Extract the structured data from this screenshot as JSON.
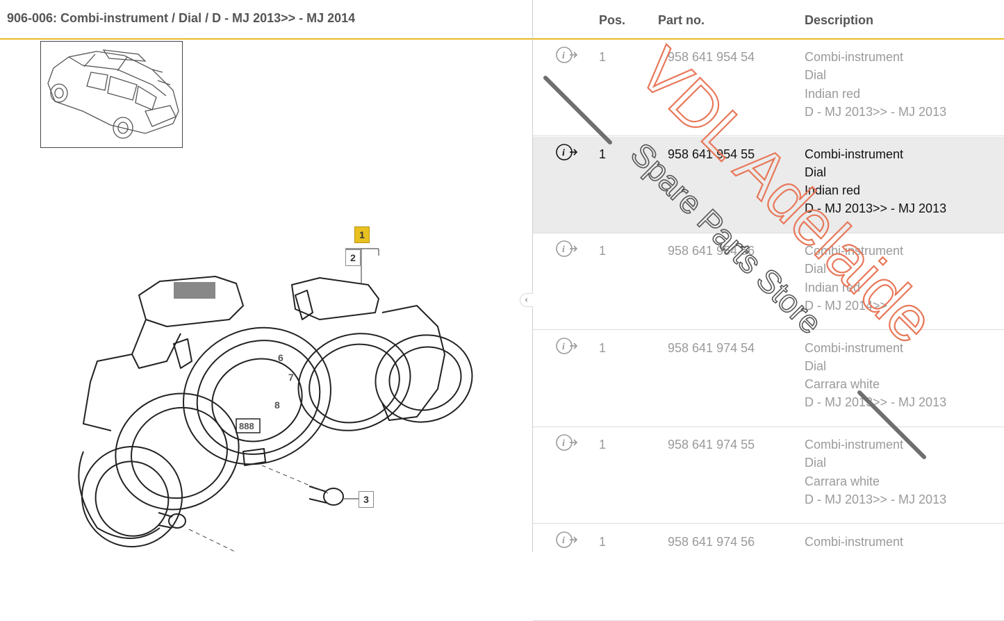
{
  "header": {
    "title": "906-006: Combi-instrument / Dial / D - MJ 2013>> - MJ 2014"
  },
  "columns": {
    "pos": "Pos.",
    "part_no": "Part no.",
    "description": "Description"
  },
  "rows": [
    {
      "pos": "1",
      "part_no": "958 641 954 54",
      "desc": [
        "Combi-instrument",
        "Dial",
        "Indian red",
        "D -    MJ 2013>> -    MJ 2013"
      ],
      "selected": false
    },
    {
      "pos": "1",
      "part_no": "958 641 954 55",
      "desc": [
        "Combi-instrument",
        "Dial",
        "Indian red",
        "D -    MJ 2013>> -    MJ 2013"
      ],
      "selected": true
    },
    {
      "pos": "1",
      "part_no": "958 641 954 56",
      "desc": [
        "Combi-instrument",
        "Dial",
        "Indian red",
        "D -    MJ 2014>>"
      ],
      "selected": false
    },
    {
      "pos": "1",
      "part_no": "958 641 974 54",
      "desc": [
        "Combi-instrument",
        "Dial",
        "Carrara white",
        "D -    MJ 2013>> -    MJ 2013"
      ],
      "selected": false
    },
    {
      "pos": "1",
      "part_no": "958 641 974 55",
      "desc": [
        "Combi-instrument",
        "Dial",
        "Carrara white",
        "D -    MJ 2013>> -    MJ 2013"
      ],
      "selected": false
    },
    {
      "pos": "1",
      "part_no": "958 641 974 56",
      "desc": [
        "Combi-instrument"
      ],
      "selected": false
    }
  ],
  "callouts": [
    {
      "label": "1",
      "active": true
    },
    {
      "label": "2",
      "active": false
    },
    {
      "label": "3",
      "active": false
    }
  ],
  "handle": {
    "label": "‹ ›"
  },
  "watermark": {
    "line1": "VDL Adelaide",
    "line2": "Spare Parts Store"
  },
  "icons": {
    "info": "info-arrow-icon",
    "thumbnail": "vehicle-thumbnail-icon"
  },
  "colors": {
    "accent": "#e8b923",
    "selected_row": "#ebebeb",
    "watermark_main": "#e8785a",
    "watermark_sub": "#555555",
    "callout_active": "#e8c020"
  }
}
